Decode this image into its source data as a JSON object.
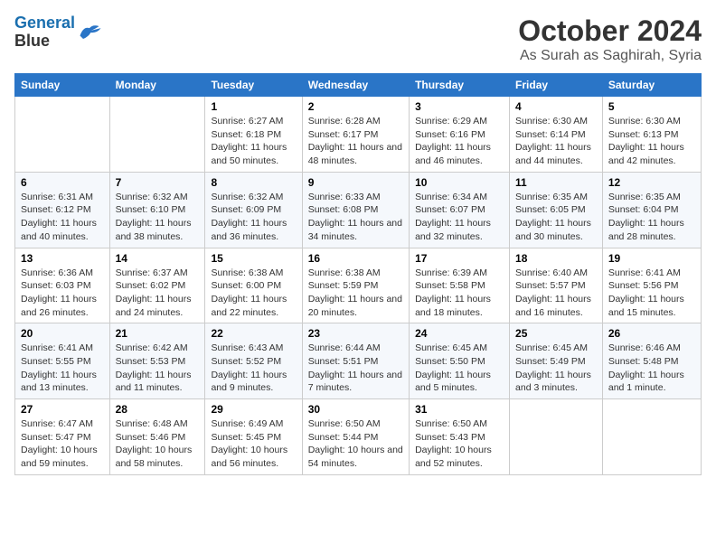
{
  "logo": {
    "line1": "General",
    "line2": "Blue"
  },
  "title": "October 2024",
  "location": "As Surah as Saghirah, Syria",
  "weekdays": [
    "Sunday",
    "Monday",
    "Tuesday",
    "Wednesday",
    "Thursday",
    "Friday",
    "Saturday"
  ],
  "weeks": [
    [
      {
        "day": null
      },
      {
        "day": null
      },
      {
        "day": "1",
        "sunrise": "6:27 AM",
        "sunset": "6:18 PM",
        "daylight": "11 hours and 50 minutes."
      },
      {
        "day": "2",
        "sunrise": "6:28 AM",
        "sunset": "6:17 PM",
        "daylight": "11 hours and 48 minutes."
      },
      {
        "day": "3",
        "sunrise": "6:29 AM",
        "sunset": "6:16 PM",
        "daylight": "11 hours and 46 minutes."
      },
      {
        "day": "4",
        "sunrise": "6:30 AM",
        "sunset": "6:14 PM",
        "daylight": "11 hours and 44 minutes."
      },
      {
        "day": "5",
        "sunrise": "6:30 AM",
        "sunset": "6:13 PM",
        "daylight": "11 hours and 42 minutes."
      }
    ],
    [
      {
        "day": "6",
        "sunrise": "6:31 AM",
        "sunset": "6:12 PM",
        "daylight": "11 hours and 40 minutes."
      },
      {
        "day": "7",
        "sunrise": "6:32 AM",
        "sunset": "6:10 PM",
        "daylight": "11 hours and 38 minutes."
      },
      {
        "day": "8",
        "sunrise": "6:32 AM",
        "sunset": "6:09 PM",
        "daylight": "11 hours and 36 minutes."
      },
      {
        "day": "9",
        "sunrise": "6:33 AM",
        "sunset": "6:08 PM",
        "daylight": "11 hours and 34 minutes."
      },
      {
        "day": "10",
        "sunrise": "6:34 AM",
        "sunset": "6:07 PM",
        "daylight": "11 hours and 32 minutes."
      },
      {
        "day": "11",
        "sunrise": "6:35 AM",
        "sunset": "6:05 PM",
        "daylight": "11 hours and 30 minutes."
      },
      {
        "day": "12",
        "sunrise": "6:35 AM",
        "sunset": "6:04 PM",
        "daylight": "11 hours and 28 minutes."
      }
    ],
    [
      {
        "day": "13",
        "sunrise": "6:36 AM",
        "sunset": "6:03 PM",
        "daylight": "11 hours and 26 minutes."
      },
      {
        "day": "14",
        "sunrise": "6:37 AM",
        "sunset": "6:02 PM",
        "daylight": "11 hours and 24 minutes."
      },
      {
        "day": "15",
        "sunrise": "6:38 AM",
        "sunset": "6:00 PM",
        "daylight": "11 hours and 22 minutes."
      },
      {
        "day": "16",
        "sunrise": "6:38 AM",
        "sunset": "5:59 PM",
        "daylight": "11 hours and 20 minutes."
      },
      {
        "day": "17",
        "sunrise": "6:39 AM",
        "sunset": "5:58 PM",
        "daylight": "11 hours and 18 minutes."
      },
      {
        "day": "18",
        "sunrise": "6:40 AM",
        "sunset": "5:57 PM",
        "daylight": "11 hours and 16 minutes."
      },
      {
        "day": "19",
        "sunrise": "6:41 AM",
        "sunset": "5:56 PM",
        "daylight": "11 hours and 15 minutes."
      }
    ],
    [
      {
        "day": "20",
        "sunrise": "6:41 AM",
        "sunset": "5:55 PM",
        "daylight": "11 hours and 13 minutes."
      },
      {
        "day": "21",
        "sunrise": "6:42 AM",
        "sunset": "5:53 PM",
        "daylight": "11 hours and 11 minutes."
      },
      {
        "day": "22",
        "sunrise": "6:43 AM",
        "sunset": "5:52 PM",
        "daylight": "11 hours and 9 minutes."
      },
      {
        "day": "23",
        "sunrise": "6:44 AM",
        "sunset": "5:51 PM",
        "daylight": "11 hours and 7 minutes."
      },
      {
        "day": "24",
        "sunrise": "6:45 AM",
        "sunset": "5:50 PM",
        "daylight": "11 hours and 5 minutes."
      },
      {
        "day": "25",
        "sunrise": "6:45 AM",
        "sunset": "5:49 PM",
        "daylight": "11 hours and 3 minutes."
      },
      {
        "day": "26",
        "sunrise": "6:46 AM",
        "sunset": "5:48 PM",
        "daylight": "11 hours and 1 minute."
      }
    ],
    [
      {
        "day": "27",
        "sunrise": "6:47 AM",
        "sunset": "5:47 PM",
        "daylight": "10 hours and 59 minutes."
      },
      {
        "day": "28",
        "sunrise": "6:48 AM",
        "sunset": "5:46 PM",
        "daylight": "10 hours and 58 minutes."
      },
      {
        "day": "29",
        "sunrise": "6:49 AM",
        "sunset": "5:45 PM",
        "daylight": "10 hours and 56 minutes."
      },
      {
        "day": "30",
        "sunrise": "6:50 AM",
        "sunset": "5:44 PM",
        "daylight": "10 hours and 54 minutes."
      },
      {
        "day": "31",
        "sunrise": "6:50 AM",
        "sunset": "5:43 PM",
        "daylight": "10 hours and 52 minutes."
      },
      {
        "day": null
      },
      {
        "day": null
      }
    ]
  ],
  "labels": {
    "sunrise_prefix": "Sunrise: ",
    "sunset_prefix": "Sunset: ",
    "daylight_prefix": "Daylight: "
  }
}
